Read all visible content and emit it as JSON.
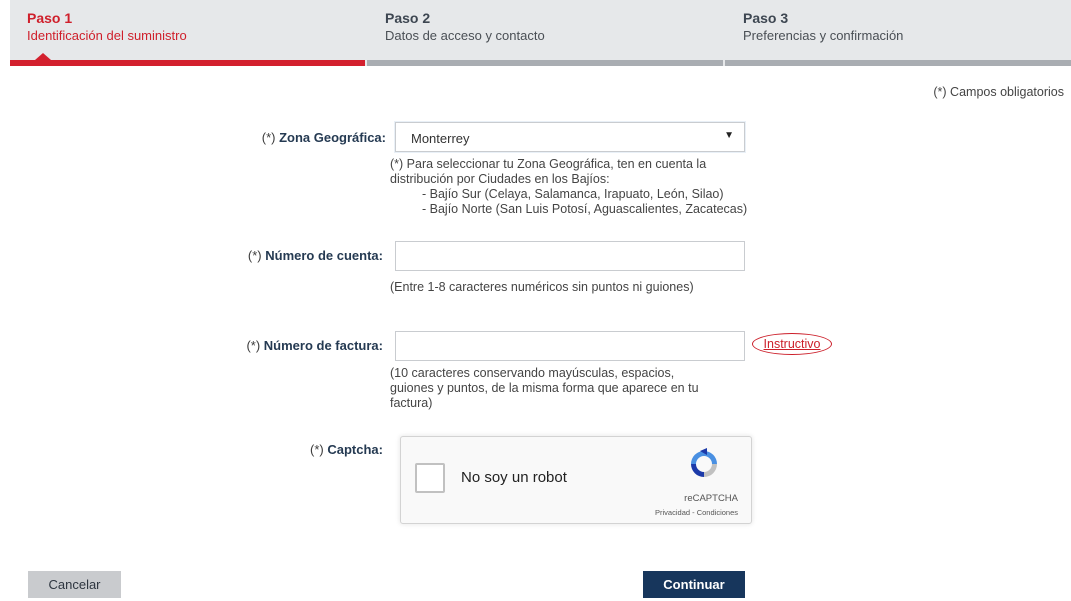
{
  "steps": [
    {
      "title": "Paso 1",
      "description": "Identificación del suministro",
      "active": true
    },
    {
      "title": "Paso 2",
      "description": "Datos de acceso y contacto",
      "active": false
    },
    {
      "title": "Paso 3",
      "description": "Preferencias y confirmación",
      "active": false
    }
  ],
  "required_note": "(*) Campos obligatorios",
  "form": {
    "required_mark": "(*)",
    "zona": {
      "label": "Zona Geográfica:",
      "selected": "Monterrey",
      "help_lines": [
        "(*) Para seleccionar tu Zona Geográfica, ten en cuenta la",
        "distribución por Ciudades en los Bajíos:",
        "- Bajío Sur (Celaya, Salamanca, Irapuato, León, Silao)",
        "- Bajío Norte (San Luis Potosí, Aguascalientes, Zacatecas)"
      ]
    },
    "cuenta": {
      "label": "Número de cuenta:",
      "value": "",
      "help": "(Entre 1-8 caracteres numéricos sin puntos ni guiones)"
    },
    "factura": {
      "label": "Número de factura:",
      "value": "",
      "link": "Instructivo",
      "help_lines": [
        "(10 caracteres conservando mayúsculas, espacios,",
        "guiones y puntos, de la misma forma que aparece en tu",
        "factura)"
      ]
    },
    "captcha": {
      "label": "Captcha:",
      "checkbox_text": "No soy un robot",
      "brand": "reCAPTCHA",
      "privacy": "Privacidad",
      "separator": " - ",
      "terms": "Condiciones"
    }
  },
  "buttons": {
    "cancel": "Cancelar",
    "continue": "Continuar"
  },
  "colors": {
    "accent": "#d3202e",
    "primary_button": "#17365c",
    "secondary_button": "#c9cbce"
  }
}
